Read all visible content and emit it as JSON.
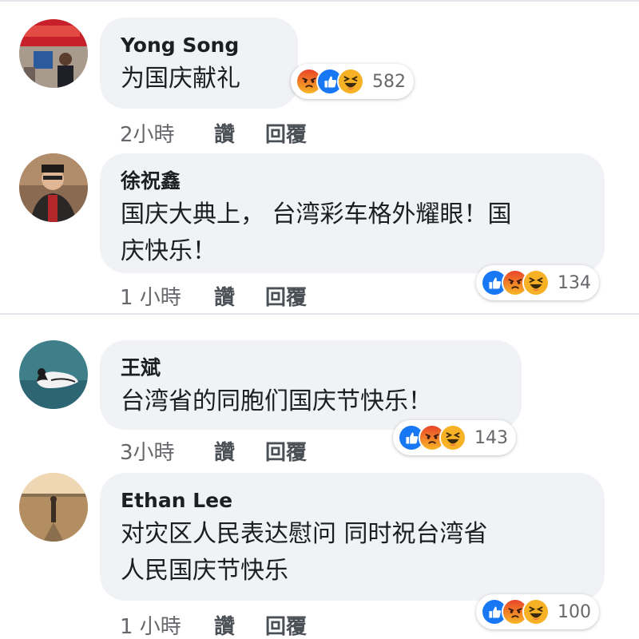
{
  "comments": [
    {
      "author": "Yong Song",
      "text": "为国庆献礼",
      "time": "2小時",
      "like_label": "讚",
      "reply_label": "回覆",
      "reactions": [
        "angry",
        "like",
        "haha"
      ],
      "reaction_count": "582"
    },
    {
      "author": "徐祝鑫",
      "text_lines": [
        "国庆大典上， 台湾彩车格外耀眼！国",
        "庆快乐！"
      ],
      "time": "1 小時",
      "like_label": "讚",
      "reply_label": "回覆",
      "reactions": [
        "like",
        "angry",
        "haha"
      ],
      "reaction_count": "134"
    },
    {
      "author": "王斌",
      "text": "台湾省的同胞们国庆节快乐！",
      "time": "3小時",
      "like_label": "讚",
      "reply_label": "回覆",
      "reactions": [
        "like",
        "angry",
        "haha"
      ],
      "reaction_count": "143"
    },
    {
      "author": "Ethan Lee",
      "text_lines": [
        "对灾区人民表达慰问 同时祝台湾省",
        "人民国庆节快乐"
      ],
      "time": "1 小時",
      "like_label": "讚",
      "reply_label": "回覆",
      "reactions": [
        "like",
        "angry",
        "haha"
      ],
      "reaction_count": "100"
    }
  ],
  "colors": {
    "like": "#1877f2",
    "angry_top": "#f15f2b",
    "angry_bottom": "#f7b125",
    "haha": "#f7b125",
    "bubble": "#f0f2f5"
  }
}
